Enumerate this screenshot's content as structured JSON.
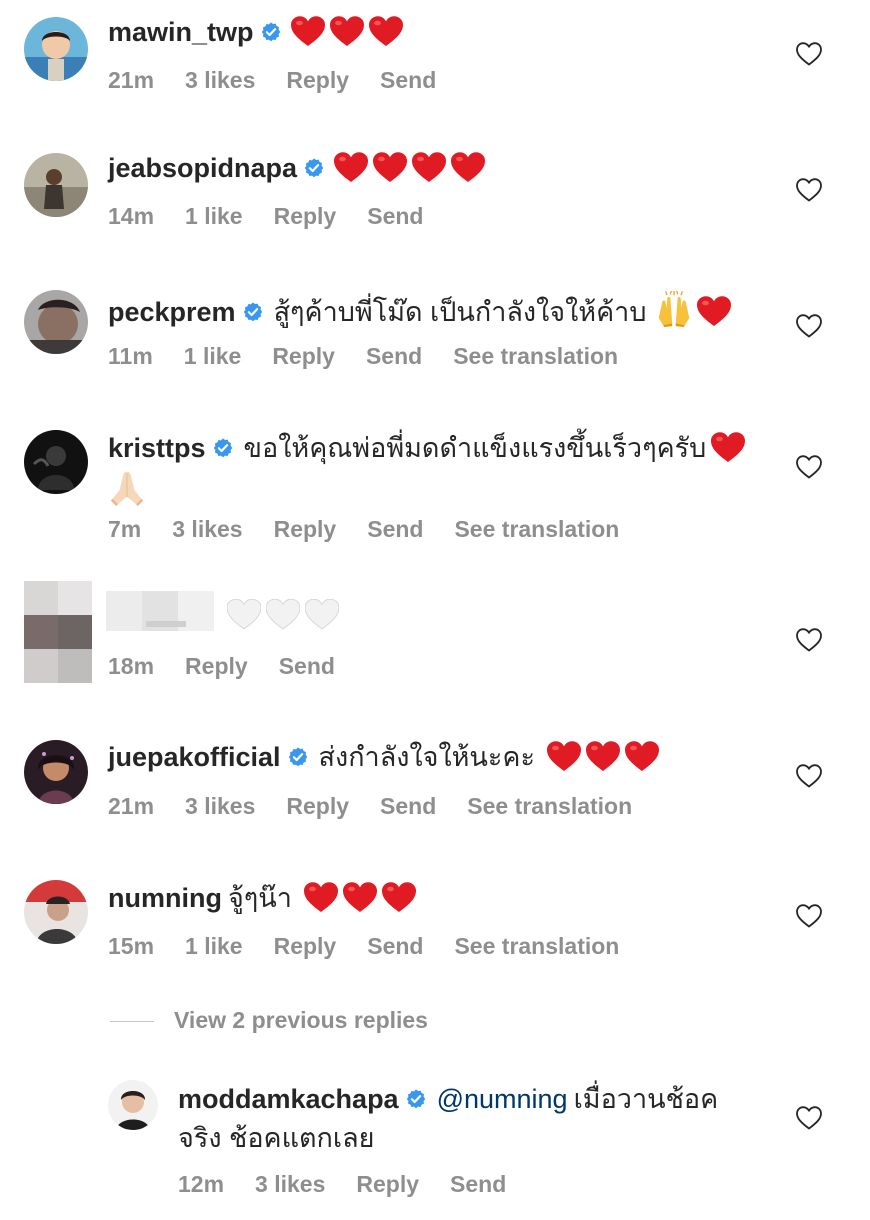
{
  "comments": [
    {
      "username": "mawin_twp",
      "verified": true,
      "text": "",
      "emoji": [
        "red-heart",
        "red-heart",
        "red-heart"
      ],
      "time": "21m",
      "likes": "3 likes",
      "reply": "Reply",
      "send": "Send",
      "translation": ""
    },
    {
      "username": "jeabsopidnapa",
      "verified": true,
      "text": "",
      "emoji": [
        "red-heart",
        "red-heart",
        "red-heart",
        "red-heart"
      ],
      "time": "14m",
      "likes": "1 like",
      "reply": "Reply",
      "send": "Send",
      "translation": ""
    },
    {
      "username": "peckprem",
      "verified": true,
      "text": "สู้ๆค้าบพี่โม๊ด เป็นกำลังใจให้ค้าบ",
      "emoji": [
        "raising-hands",
        "red-heart"
      ],
      "time": "11m",
      "likes": "1 like",
      "reply": "Reply",
      "send": "Send",
      "translation": "See translation"
    },
    {
      "username": "kristtps",
      "verified": true,
      "text": "ขอให้คุณพ่อพี่มดดำแข็งแรงขึ้นเร็วๆครับ",
      "emoji": [
        "red-heart"
      ],
      "second_line_emoji": [
        "folded-hands"
      ],
      "time": "7m",
      "likes": "3 likes",
      "reply": "Reply",
      "send": "Send",
      "translation": "See translation"
    },
    {
      "username": "",
      "verified": false,
      "text": "",
      "emoji": [
        "white-heart",
        "white-heart",
        "white-heart"
      ],
      "time": "18m",
      "likes": "",
      "reply": "Reply",
      "send": "Send",
      "translation": ""
    },
    {
      "username": "juepakofficial",
      "verified": true,
      "text": "ส่งกำลังใจให้นะคะ",
      "emoji": [
        "red-heart",
        "red-heart",
        "red-heart"
      ],
      "time": "21m",
      "likes": "3 likes",
      "reply": "Reply",
      "send": "Send",
      "translation": "See translation"
    },
    {
      "username": "numning",
      "verified": false,
      "text": "จู้ๆน๊า",
      "emoji": [
        "red-heart",
        "red-heart",
        "red-heart"
      ],
      "time": "15m",
      "likes": "1 like",
      "reply": "Reply",
      "send": "Send",
      "translation": "See translation"
    }
  ],
  "view_replies": "View 2 previous replies",
  "reply_comment": {
    "username": "moddamkachapa",
    "verified": true,
    "mention": "@numning",
    "text_line1": "เมื่อวานช้อค",
    "text_line2": "จริง ช้อคแตกเลย",
    "time": "12m",
    "likes": "3 likes",
    "reply": "Reply",
    "send": "Send"
  },
  "colors": {
    "primary_text": "#262626",
    "secondary_text": "#8e8e8e",
    "mention": "#00376b",
    "verified_badge": "#3897f0",
    "heart_red": "#ed1c24"
  }
}
